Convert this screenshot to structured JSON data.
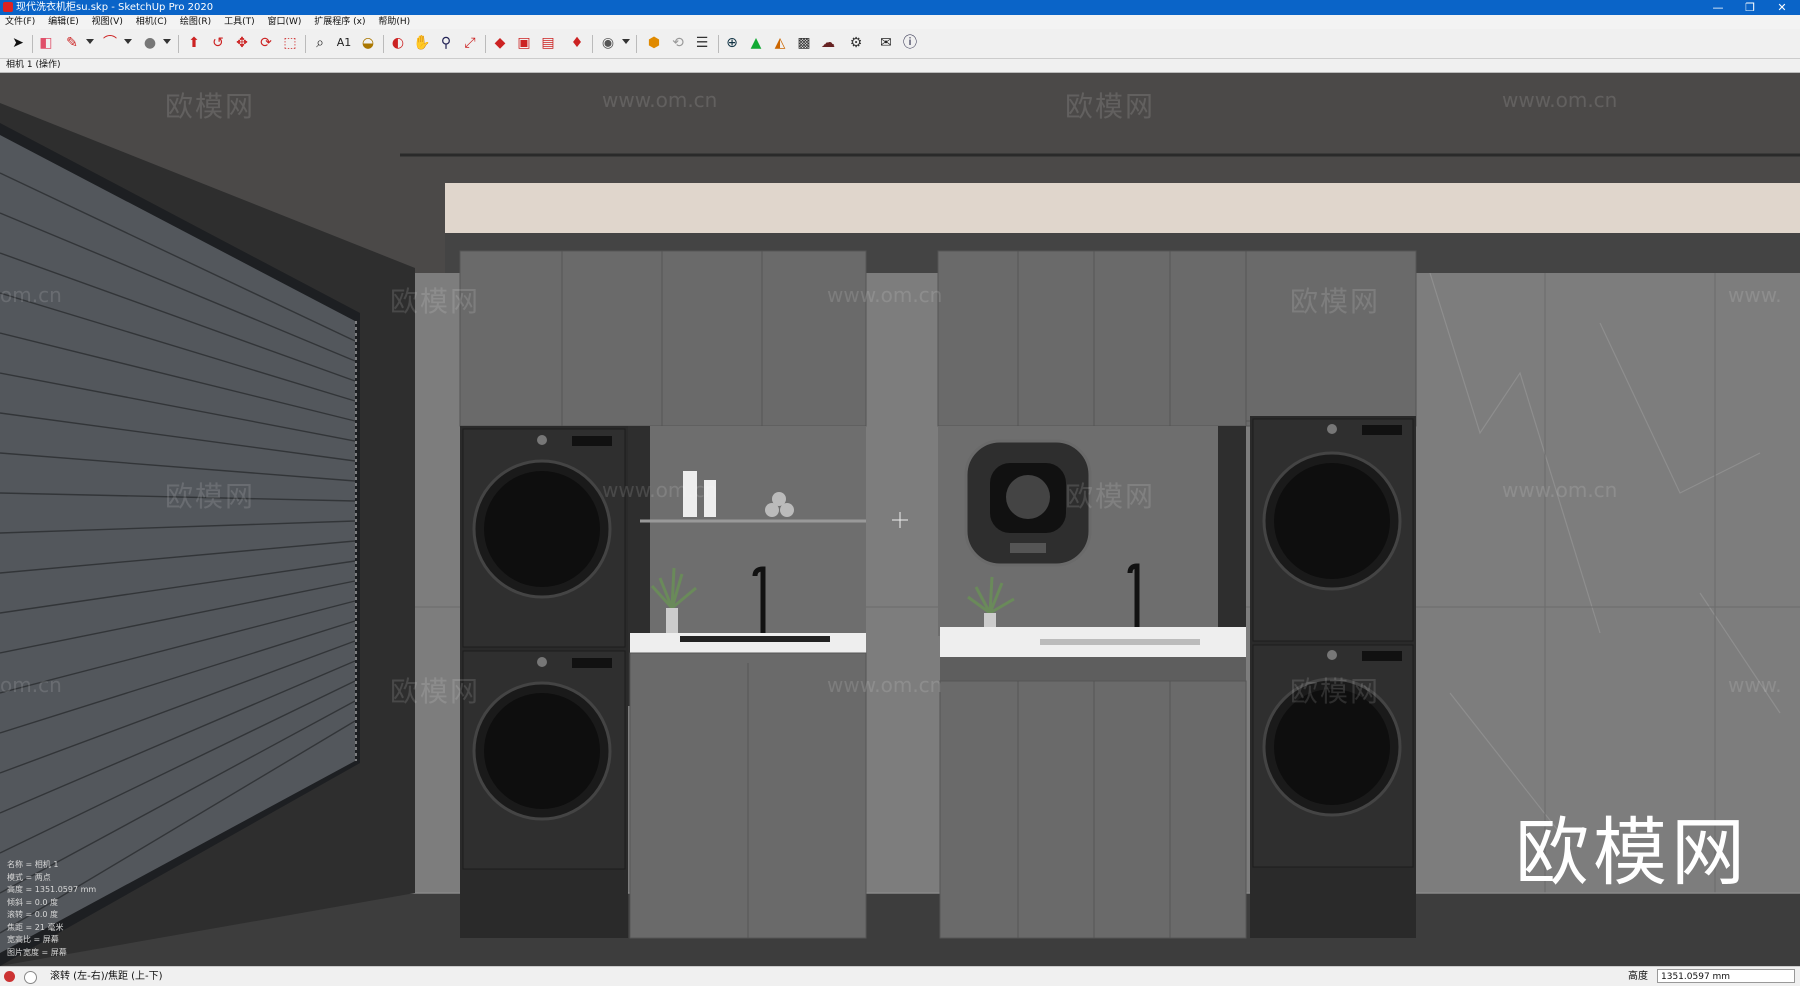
{
  "window": {
    "title": "现代洗衣机柜su.skp - SketchUp Pro 2020",
    "minimize": "—",
    "restore": "❐",
    "close": "✕"
  },
  "menu": {
    "items": [
      "文件(F)",
      "编辑(E)",
      "视图(V)",
      "相机(C)",
      "绘图(R)",
      "工具(T)",
      "窗口(W)",
      "扩展程序 (x)",
      "帮助(H)"
    ]
  },
  "toolbar": {
    "icons": [
      "select-arrow-icon",
      "eraser-icon",
      "pencil-line-icon",
      "arc-icon",
      "circle-shape-icon",
      "push-pull-icon",
      "follow-me-icon",
      "move-icon",
      "rotate-icon",
      "scale-icon",
      "tape-measure-icon",
      "text-label-icon",
      "paint-bucket-icon",
      "orbit-icon",
      "pan-icon",
      "zoom-icon",
      "zoom-extents-icon",
      "ruby-gem-icon",
      "extension-warehouse-icon",
      "layout-icon",
      "sketchup-ruby-icon",
      "account-icon",
      "sketchup-logo-icon",
      "sync-icon",
      "layer-stack-icon",
      "add-location-icon",
      "tree-icon",
      "terrain-icon",
      "checker-icon",
      "cloud-upload-icon",
      "settings-gear-icon",
      "mail-icon",
      "info-icon"
    ]
  },
  "scene_tab": "相机 1 (操作)",
  "viewport": {
    "watermark_brand": "欧模网",
    "watermark_url": "www.om.cn",
    "watermark_url_partial": "om.cn",
    "watermark_url_partial_right": "www.",
    "logo_text": "欧模网",
    "camera_info": [
      "名称 = 相机 1",
      "模式 = 两点",
      "高度 = 1351.0597 mm",
      "倾斜 = 0.0 度",
      "滚转 = 0.0 度",
      "焦距 = 21 毫米",
      "宽高比 = 屏幕",
      "图片宽度 = 屏幕"
    ]
  },
  "status": {
    "message": "滚转 (左-右)/焦距 (上-下)",
    "measure_label": "高度",
    "measure_value": "1351.0597 mm"
  }
}
